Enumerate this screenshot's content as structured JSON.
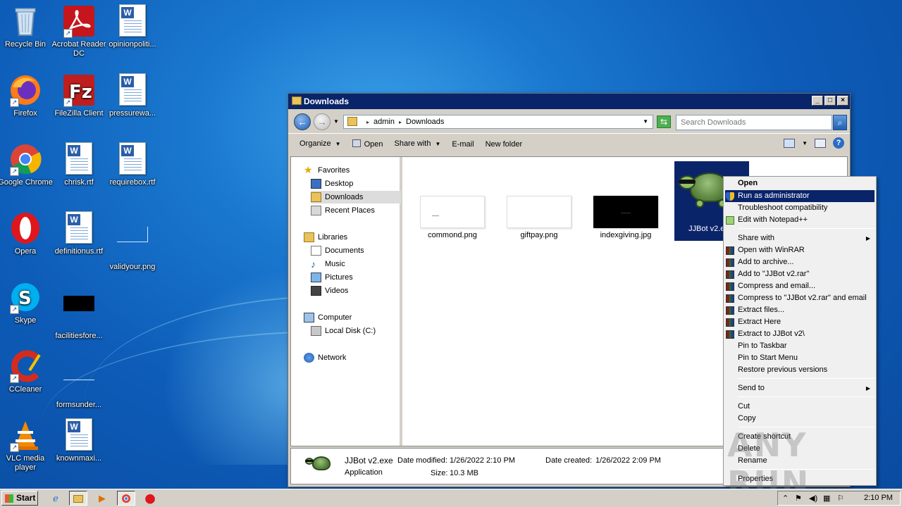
{
  "desktop": {
    "icons": [
      {
        "label": "Recycle Bin",
        "icon": "recycle-bin-icon"
      },
      {
        "label": "Acrobat Reader DC",
        "icon": "acrobat-icon"
      },
      {
        "label": "opinionpoliti...",
        "icon": "word-doc-icon"
      },
      {
        "label": "Firefox",
        "icon": "firefox-icon"
      },
      {
        "label": "FileZilla Client",
        "icon": "filezilla-icon"
      },
      {
        "label": "pressurewa...",
        "icon": "word-doc-icon"
      },
      {
        "label": "Google Chrome",
        "icon": "chrome-icon"
      },
      {
        "label": "chrisk.rtf",
        "icon": "word-doc-icon"
      },
      {
        "label": "requirebox.rtf",
        "icon": "word-doc-icon"
      },
      {
        "label": "Opera",
        "icon": "opera-icon"
      },
      {
        "label": "definitionus.rtf",
        "icon": "word-doc-icon"
      },
      {
        "label": "validyour.png",
        "icon": "image-icon"
      },
      {
        "label": "Skype",
        "icon": "skype-icon"
      },
      {
        "label": "facilitiesfore...",
        "icon": "image-icon"
      },
      {
        "label": "CCleaner",
        "icon": "ccleaner-icon"
      },
      {
        "label": "formsunder...",
        "icon": "image-icon"
      },
      {
        "label": "VLC media player",
        "icon": "vlc-icon"
      },
      {
        "label": "knownmaxi...",
        "icon": "word-doc-icon"
      }
    ]
  },
  "window": {
    "title": "Downloads",
    "breadcrumb": [
      "admin",
      "Downloads"
    ],
    "search_placeholder": "Search Downloads",
    "toolbar": {
      "organize": "Organize",
      "open": "Open",
      "share_with": "Share with",
      "email": "E-mail",
      "new_folder": "New folder"
    },
    "nav": {
      "favorites": "Favorites",
      "desktop": "Desktop",
      "downloads": "Downloads",
      "recent_places": "Recent Places",
      "libraries": "Libraries",
      "documents": "Documents",
      "music": "Music",
      "pictures": "Pictures",
      "videos": "Videos",
      "computer": "Computer",
      "local_disk": "Local Disk (C:)",
      "network": "Network"
    },
    "files": [
      {
        "name": "commond.png"
      },
      {
        "name": "giftpay.png"
      },
      {
        "name": "indexgiving.jpg"
      },
      {
        "name": "JJBot v2.e"
      }
    ],
    "details": {
      "name": "JJBot v2.exe",
      "type": "Application",
      "date_modified_label": "Date modified:",
      "date_modified": "1/26/2022 2:10 PM",
      "size_label": "Size:",
      "size": "10.3 MB",
      "date_created_label": "Date created:",
      "date_created": "1/26/2022 2:09 PM"
    }
  },
  "context_menu": {
    "open": "Open",
    "run_as_admin": "Run as administrator",
    "troubleshoot": "Troubleshoot compatibility",
    "edit_notepad": "Edit with Notepad++",
    "share_with": "Share with",
    "open_winrar": "Open with WinRAR",
    "add_archive": "Add to archive...",
    "add_rar": "Add to \"JJBot v2.rar\"",
    "compress_email": "Compress and email...",
    "compress_rar_email": "Compress to \"JJBot v2.rar\" and email",
    "extract_files": "Extract files...",
    "extract_here": "Extract Here",
    "extract_to": "Extract to JJBot v2\\",
    "pin_taskbar": "Pin to Taskbar",
    "pin_start": "Pin to Start Menu",
    "restore": "Restore previous versions",
    "send_to": "Send to",
    "cut": "Cut",
    "copy": "Copy",
    "create_shortcut": "Create shortcut",
    "delete": "Delete",
    "rename": "Rename",
    "properties": "Properties"
  },
  "watermark": "ANY RUN",
  "taskbar": {
    "start": "Start",
    "clock": "2:10 PM"
  }
}
